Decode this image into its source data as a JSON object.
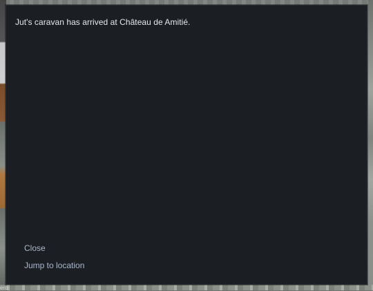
{
  "background": {
    "corner_label": "ero"
  },
  "dialog": {
    "message": "Jut's caravan has arrived at Château de Amitié.",
    "options": [
      {
        "label": "Close"
      },
      {
        "label": "Jump to location"
      }
    ]
  },
  "colors": {
    "dialog_background": "#1b1e23",
    "message_text": "#e6e8eb",
    "option_text": "#aab8cc"
  }
}
